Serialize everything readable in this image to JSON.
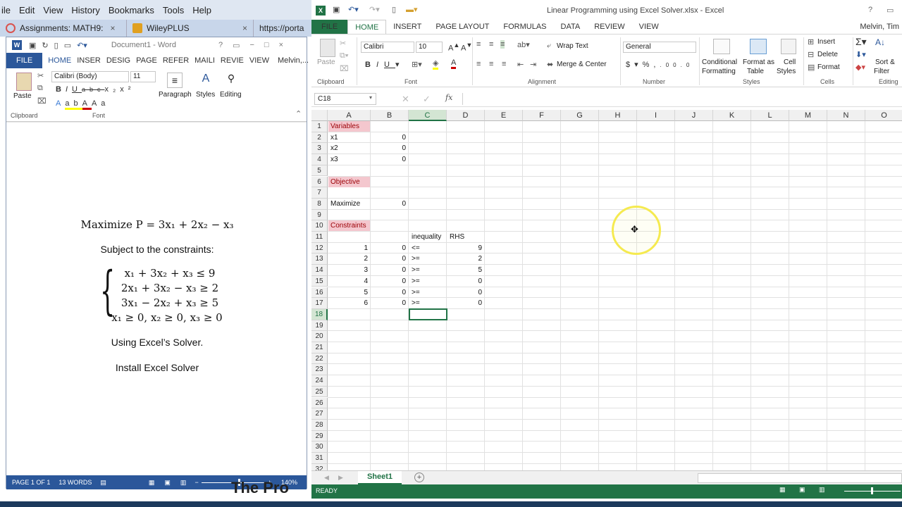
{
  "firefox": {
    "menu": [
      "ile",
      "Edit",
      "View",
      "History",
      "Bookmarks",
      "Tools",
      "Help"
    ],
    "tabs": [
      {
        "label": "Assignments: MATH9:",
        "color": "#d9534f"
      },
      {
        "label": "WileyPLUS",
        "color": "#e0a020"
      },
      {
        "label": "https://porta",
        "color": "#c8d6ea"
      }
    ]
  },
  "word": {
    "title": "Document1 - Word",
    "user": "Melvin,...",
    "tabs": [
      "FILE",
      "HOME",
      "INSER",
      "DESIG",
      "PAGE",
      "REFER",
      "MAILI",
      "REVIE",
      "VIEW"
    ],
    "font_name": "Calibri (Body)",
    "font_size": "11",
    "groups": {
      "clipboard": "Clipboard",
      "font": "Font"
    },
    "buttons": {
      "paste": "Paste",
      "paragraph": "Paragraph",
      "styles": "Styles",
      "editing": "Editing"
    },
    "doc": {
      "objective": "Maximize P = 3x₁ + 2x₂ − x₃",
      "subject": "Subject to the constraints:",
      "constraints": [
        "x₁ + 3x₂ + x₃ ≤ 9",
        "2x₁ + 3x₂ − x₃ ≥ 2",
        "3x₁ − 2x₂ + x₃ ≥ 5",
        "x₁ ≥ 0, x₂ ≥ 0, x₃ ≥ 0"
      ],
      "using": "Using Excel’s Solver.",
      "install": "Install Excel Solver"
    },
    "status": {
      "page": "PAGE 1 OF 1",
      "words": "13 WORDS",
      "zoom": "140%"
    },
    "overlay_text": "The Pro"
  },
  "excel": {
    "title": "Linear Programming using Excel Solver.xlsx - Excel",
    "user": "Melvin, Tim",
    "tabs": [
      "FILE",
      "HOME",
      "INSERT",
      "PAGE LAYOUT",
      "FORMULAS",
      "DATA",
      "REVIEW",
      "VIEW"
    ],
    "font_name": "Calibri",
    "font_size": "10",
    "number_format": "General",
    "buttons": {
      "paste": "Paste",
      "wrap": "Wrap Text",
      "merge": "Merge & Center",
      "cond1": "Conditional",
      "cond2": "Formatting",
      "fat1": "Format as",
      "fat2": "Table",
      "cs1": "Cell",
      "cs2": "Styles",
      "insert": "Insert",
      "delete": "Delete",
      "format": "Format",
      "sort1": "Sort &",
      "sort2": "Filter"
    },
    "groups": {
      "clipboard": "Clipboard",
      "font": "Font",
      "alignment": "Alignment",
      "number": "Number",
      "styles": "Styles",
      "cells": "Cells",
      "editing": "Editing"
    },
    "namebox": "C18",
    "columns": [
      "A",
      "B",
      "C",
      "D",
      "E",
      "F",
      "G",
      "H",
      "I",
      "J",
      "K",
      "L",
      "M",
      "N",
      "O"
    ],
    "rows": [
      "1",
      "2",
      "3",
      "4",
      "5",
      "6",
      "7",
      "8",
      "9",
      "10",
      "11",
      "12",
      "13",
      "14",
      "15",
      "16",
      "17",
      "18",
      "19",
      "20",
      "21",
      "22",
      "23",
      "24",
      "25",
      "26",
      "27",
      "28",
      "29",
      "30",
      "31",
      "32"
    ],
    "cells": {
      "A1": "Variables",
      "A2": "x1",
      "B2": "0",
      "A3": "x2",
      "B3": "0",
      "A4": "x3",
      "B4": "0",
      "A6": "Objective",
      "A8": "Maximize",
      "B8": "0",
      "A10": "Constraints",
      "C11": "inequality",
      "D11": "RHS",
      "A12": "1",
      "B12": "0",
      "C12": "<=",
      "D12": "9",
      "A13": "2",
      "B13": "0",
      "C13": ">=",
      "D13": "2",
      "A14": "3",
      "B14": "0",
      "C14": ">=",
      "D14": "5",
      "A15": "4",
      "B15": "0",
      "C15": ">=",
      "D15": "0",
      "A16": "5",
      "B16": "0",
      "C16": ">=",
      "D16": "0",
      "A17": "6",
      "B17": "0",
      "C17": ">=",
      "D17": "0"
    },
    "sheet_tab": "Sheet1",
    "status": "READY"
  }
}
